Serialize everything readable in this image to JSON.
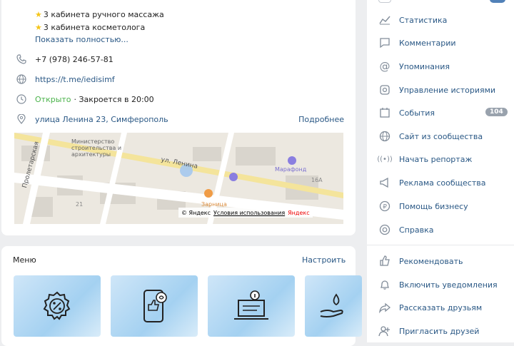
{
  "info": {
    "lines": [
      "3 кабинета ручного массажа",
      "3 кабинета косметолога"
    ],
    "show_more": "Показать полностью...",
    "phone": "+7 (978) 246-57-81",
    "site": "https://t.me/iedisimf",
    "open": "Открыто",
    "closes": "· Закроется в 20:00",
    "address": "улица Ленина 23, Симферополь",
    "details": "Подробнее"
  },
  "map": {
    "street1": "ул. Ленина",
    "street2": "Пролетарская",
    "poi1": "Министерство строительства и архитектуры",
    "poi2": "Марафонд",
    "poi3": "Зарница",
    "num1": "21",
    "num2": "16А",
    "copyright": "© Яндекс",
    "terms": "Условия использования",
    "brand": "Яндекс"
  },
  "menu": {
    "title": "Меню",
    "configure": "Настроить"
  },
  "sidebar": {
    "items": [
      {
        "label": "Статистика",
        "icon": "chart-icon"
      },
      {
        "label": "Комментарии",
        "icon": "comment-icon"
      },
      {
        "label": "Упоминания",
        "icon": "at-icon"
      },
      {
        "label": "Управление историями",
        "icon": "stories-icon"
      },
      {
        "label": "События",
        "icon": "events-icon",
        "badge": "104"
      },
      {
        "label": "Сайт из сообщества",
        "icon": "globe-icon"
      },
      {
        "label": "Начать репортаж",
        "icon": "broadcast-icon"
      },
      {
        "label": "Реклама сообщества",
        "icon": "megaphone-icon"
      },
      {
        "label": "Помощь бизнесу",
        "icon": "business-icon"
      },
      {
        "label": "Справка",
        "icon": "help-icon"
      },
      {
        "label": "Рекомендовать",
        "icon": "like-icon"
      },
      {
        "label": "Включить уведомления",
        "icon": "bell-icon"
      },
      {
        "label": "Рассказать друзьям",
        "icon": "share-icon"
      },
      {
        "label": "Пригласить друзей",
        "icon": "invite-icon"
      }
    ]
  }
}
